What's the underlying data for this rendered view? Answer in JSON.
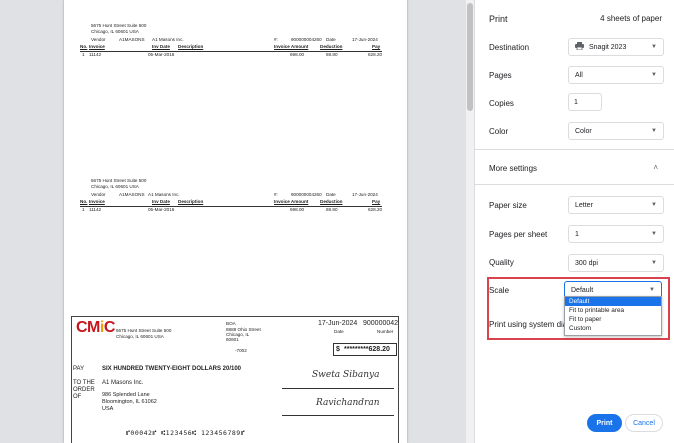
{
  "preview": {
    "stub": {
      "address1": "5675 Hunt Street Suite 500",
      "address2": "Chicago, IL 60601 USA",
      "vendor_label": "Vendor",
      "vendor_code": "A1MASONS",
      "vendor_name": "A1 Masons Inc.",
      "hash_label": "#:",
      "check_no": "900000004260",
      "date_label": "Date",
      "date": "17-Jun-2024",
      "headers": [
        "No.",
        "Invoice",
        "Inv Date",
        "Description",
        "Invoice Amount",
        "Deduction",
        "Pay"
      ],
      "row": [
        "1",
        "11142",
        "05-Mar-2016",
        "",
        "698.00",
        "69.80",
        "628.20"
      ]
    },
    "check": {
      "logo_main": "CM",
      "logo_i": "i",
      "logo_end": "C",
      "company_addr1": "5675 Hunt Street Suite 500",
      "company_addr2": "Chicago, IL 60601 USA",
      "bank_name": "BOA",
      "bank_addr1": "8888 Ohio Street",
      "bank_addr2": "Chicago, IL",
      "bank_addr3": "60601",
      "routing": "-7002",
      "date": "17-Jun-2024",
      "number": "900000042",
      "date_label": "Date",
      "number_label": "Number",
      "amount": "*********628.20",
      "pay_label": "PAY",
      "pay_words": "SIX HUNDRED TWENTY-EIGHT DOLLARS 20/100",
      "to_label1": "TO THE",
      "to_label2": "ORDER",
      "to_label3": "OF",
      "payee_name": "A1 Masons Inc.",
      "payee_addr1": "986 Splended Lane",
      "payee_addr2": "Bloomington,  IL  61062",
      "payee_addr3": "USA",
      "signature1": "Sweta Sibanya",
      "signature2": "Ravichandran",
      "micr": "⑈00042⑈ ⑆123456⑆ 123456789⑈"
    }
  },
  "panel": {
    "title": "Print",
    "sheets": "4 sheets of paper",
    "destination_label": "Destination",
    "destination_value": "Snagit 2023",
    "pages_label": "Pages",
    "pages_value": "All",
    "copies_label": "Copies",
    "copies_value": "1",
    "color_label": "Color",
    "color_value": "Color",
    "more_settings": "More settings",
    "paper_size_label": "Paper size",
    "paper_size_value": "Letter",
    "pages_per_sheet_label": "Pages per sheet",
    "pages_per_sheet_value": "1",
    "quality_label": "Quality",
    "quality_value": "300 dpi",
    "scale_label": "Scale",
    "scale_value": "Default",
    "scale_options": [
      "Default",
      "Fit to printable area",
      "Fit to paper",
      "Custom"
    ],
    "system_dialog": "Print using system dialog",
    "print_button": "Print",
    "cancel_button": "Cancel"
  },
  "colors": {
    "accent": "#1a73e8",
    "highlight": "#d9434e",
    "logo_red": "#c4161c"
  }
}
